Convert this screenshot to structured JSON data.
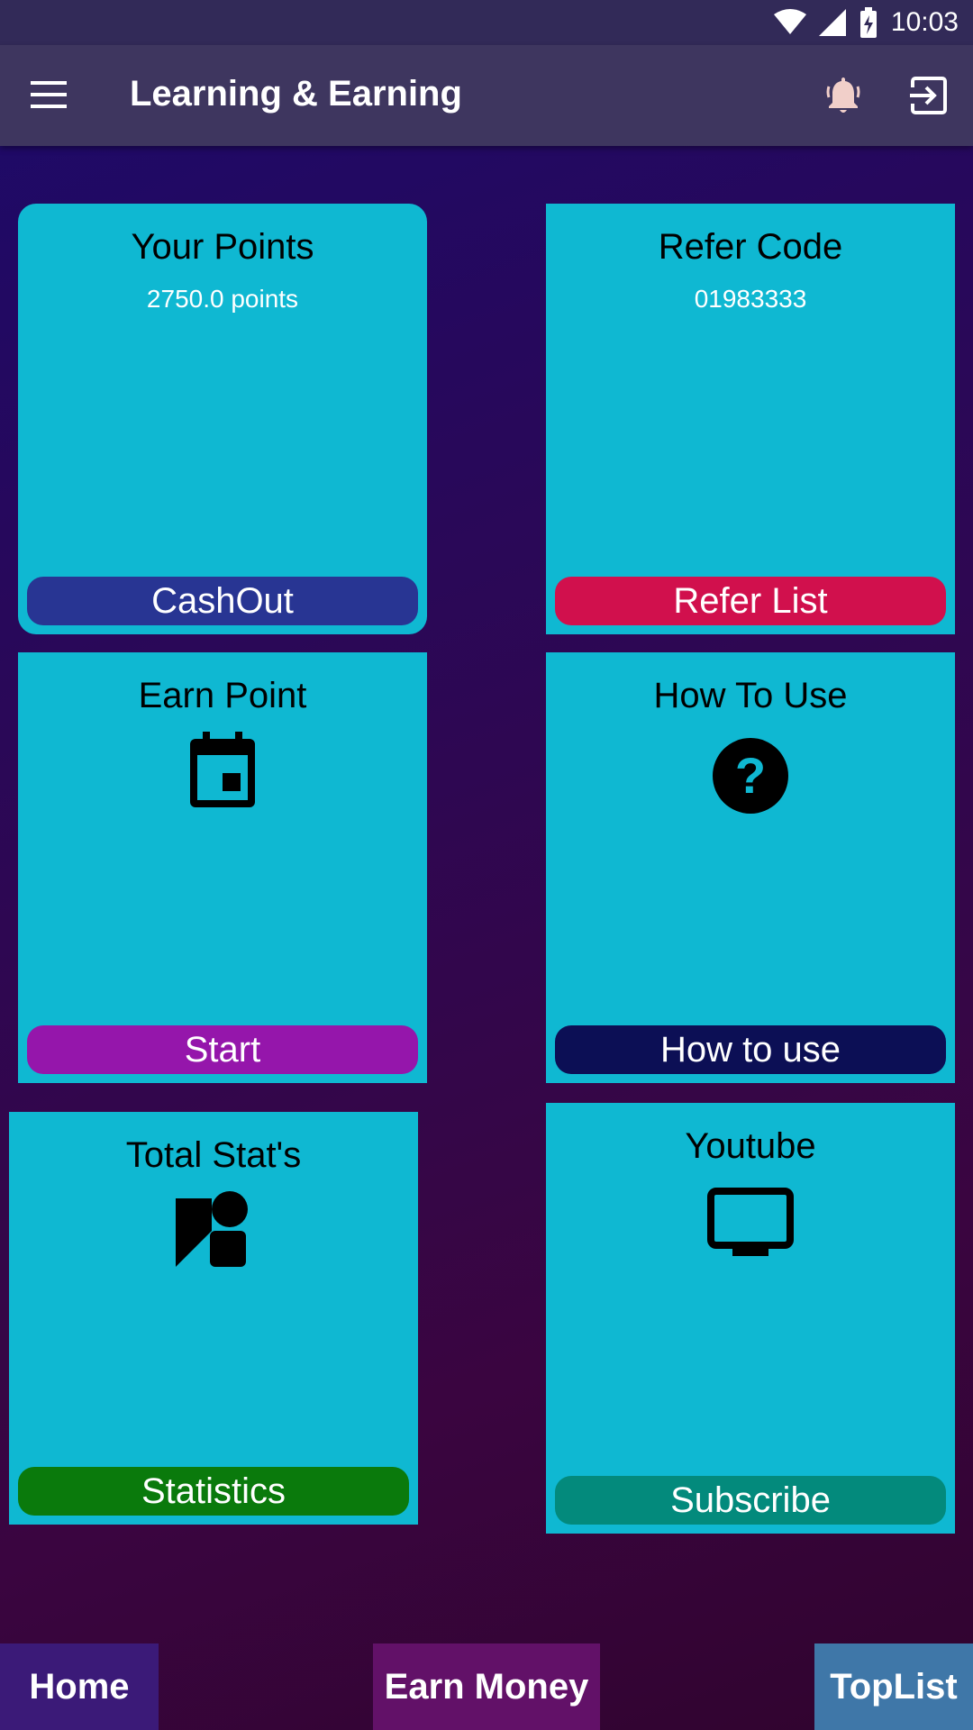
{
  "status_bar": {
    "time": "10:03",
    "icons": [
      "wifi-icon",
      "signal-icon",
      "battery-icon"
    ]
  },
  "app_bar": {
    "title": "Learning & Earning",
    "icons": [
      "menu-icon",
      "notification-bell-icon",
      "logout-icon"
    ]
  },
  "cards": {
    "points": {
      "title": "Your Points",
      "subtitle": "2750.0 points",
      "button": "CashOut",
      "button_color": "#283593"
    },
    "refer": {
      "title": "Refer Code",
      "subtitle": "01983333",
      "button": "Refer List",
      "button_color": "#d1104d"
    },
    "earn": {
      "title": "Earn Point",
      "icon": "calendar-icon",
      "button": "Start",
      "button_color": "#9516ab"
    },
    "howto": {
      "title": "How To Use",
      "icon": "help-circle-icon",
      "button": "How to use",
      "button_color": "#0c0f55"
    },
    "stats": {
      "title": "Total Stat's",
      "icon": "statistics-person-icon",
      "button": "Statistics",
      "button_color": "#0a7a0c"
    },
    "youtube": {
      "title": "Youtube",
      "icon": "tv-icon",
      "button": "Subscribe",
      "button_color": "#038a7c"
    }
  },
  "bottom_nav": {
    "home": "Home",
    "earn_money": "Earn Money",
    "toplist": "TopList"
  },
  "colors": {
    "card": "#0fb8d2",
    "app_bar": "#3e365f",
    "home_tab": "#3b1a78",
    "earn_money_tab": "#621168",
    "toplist_tab": "#3f77a8"
  }
}
